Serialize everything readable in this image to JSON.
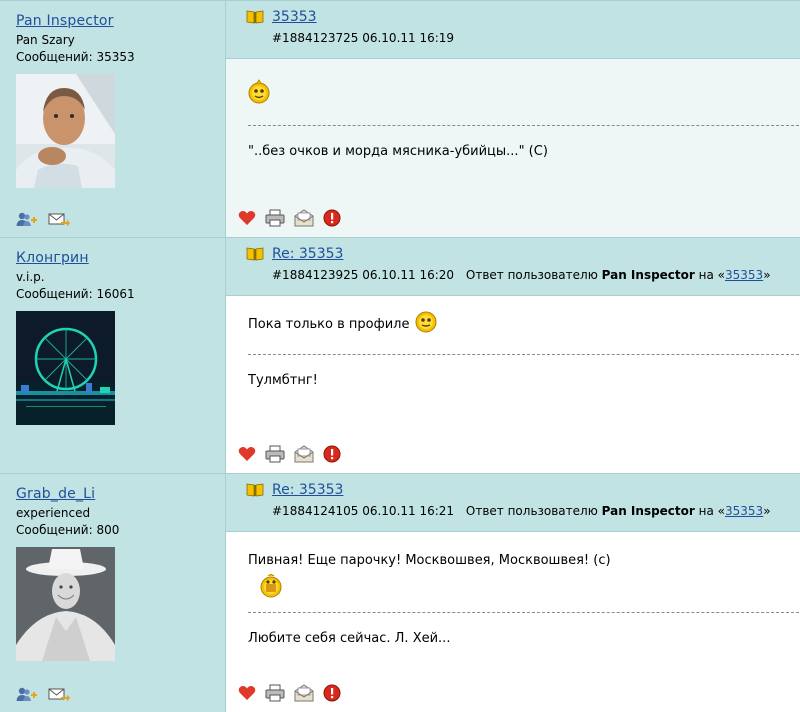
{
  "posts": [
    {
      "author": {
        "name": "Pan Inspector",
        "rank": "Pan Szary",
        "count": "Сообщений: 35353"
      },
      "title": "35353",
      "meta": "#1884123725 06.10.11 16:19",
      "reply_prefix": "",
      "reply_user": "",
      "reply_middle": "",
      "reply_link": "",
      "reply_end": "",
      "message": "",
      "signature": "\"..без очков и морда мясника-убийцы...\" (С)"
    },
    {
      "author": {
        "name": "Клонгрин",
        "rank": "v.i.p.",
        "count": "Сообщений: 16061"
      },
      "title": "Re: 35353",
      "meta": "#1884123925 06.10.11 16:20",
      "reply_prefix": "Ответ пользователю",
      "reply_user": "Pan Inspector",
      "reply_middle": "на «",
      "reply_link": "35353",
      "reply_end": "»",
      "message": "Пока только в профиле",
      "signature": "Тулмбтнг!"
    },
    {
      "author": {
        "name": "Grab_de_Li",
        "rank": "experienced",
        "count": "Сообщений: 800"
      },
      "title": "Re: 35353",
      "meta": "#1884124105 06.10.11 16:21",
      "reply_prefix": "Ответ пользователю",
      "reply_user": "Pan Inspector",
      "reply_middle": "на «",
      "reply_link": "35353",
      "reply_end": "»",
      "message": "Пивная! Еще парочку! Москвошвея, Москвошвея! (с)",
      "signature": "Любите себя сейчас. Л. Хей..."
    }
  ],
  "colors": {
    "panel": "#c2e3e3",
    "link": "#1f4f9a",
    "border": "#a7cfcf"
  },
  "icons": [
    "add-friend-icon",
    "send-message-icon",
    "heart-icon",
    "print-icon",
    "mail-icon",
    "report-icon",
    "book-icon",
    "smiley-icon"
  ]
}
